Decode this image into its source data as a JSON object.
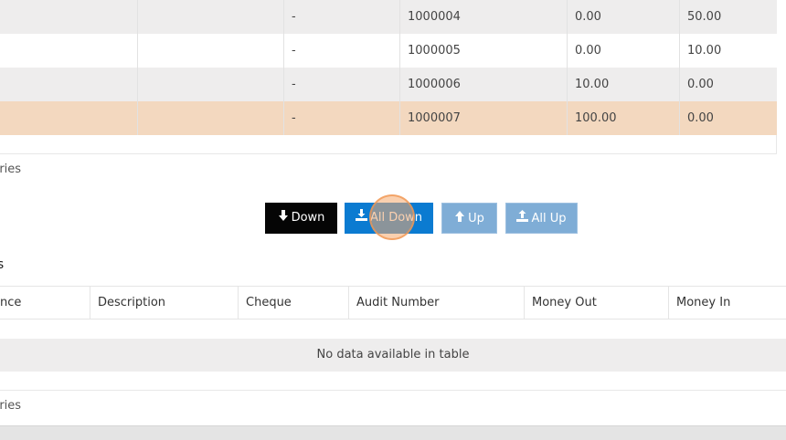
{
  "top_table": {
    "rows": [
      {
        "c1": "",
        "c2": "",
        "c3": "-",
        "audit": "1000004",
        "money_out": "0.00",
        "money_in": "50.00",
        "style": "grey"
      },
      {
        "c1": "",
        "c2": "",
        "c3": "-",
        "audit": "1000005",
        "money_out": "0.00",
        "money_in": "10.00",
        "style": "white"
      },
      {
        "c1": "",
        "c2": "",
        "c3": "-",
        "audit": "1000006",
        "money_out": "10.00",
        "money_in": "0.00",
        "style": "grey"
      },
      {
        "c1": "",
        "c2": "",
        "c3": "-",
        "audit": "1000007",
        "money_out": "100.00",
        "money_in": "0.00",
        "style": "selected"
      }
    ],
    "info_text": "ntries"
  },
  "buttons": {
    "down": {
      "label": "Down",
      "icon": "arrow-down-icon"
    },
    "all_down": {
      "label": "All Down",
      "icon": "download-icon"
    },
    "up": {
      "label": "Up",
      "icon": "arrow-up-icon"
    },
    "all_up": {
      "label": "All Up",
      "icon": "upload-icon"
    }
  },
  "bottom_section": {
    "title": "ns",
    "columns": [
      "nce",
      "Description",
      "Cheque",
      "Audit Number",
      "Money Out",
      "Money In"
    ],
    "empty_message": "No data available in table",
    "info_text": "ntries"
  },
  "colors": {
    "selected_row": "#f3d8bf",
    "grey_row": "#eeeded",
    "primary_button": "#0b7bd1",
    "disabled_button": "#7fadd6",
    "dark_button": "#050505"
  }
}
